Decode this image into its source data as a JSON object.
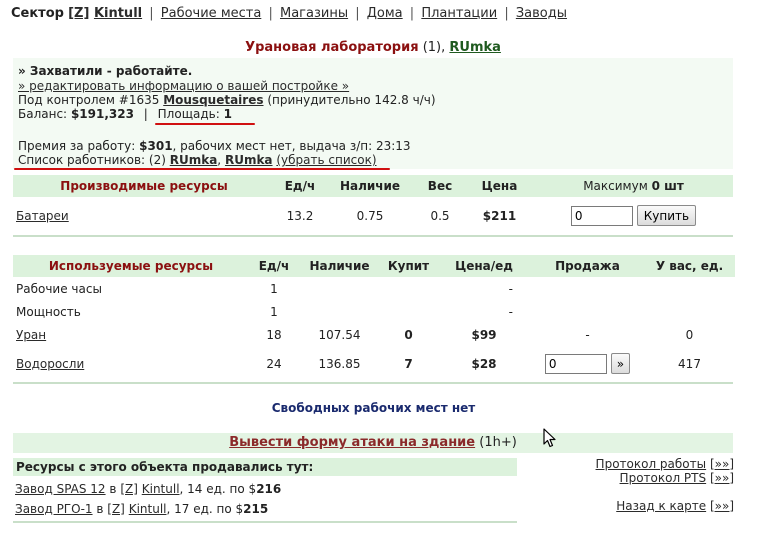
{
  "nav": {
    "sector_label": "Сектор",
    "clan_tag": "[Z]",
    "sector_name": "Kintull",
    "links": [
      "Рабочие места",
      "Магазины",
      "Дома",
      "Плантации",
      "Заводы"
    ],
    "separator": "|"
  },
  "building": {
    "name": "Урановая лаборатория",
    "level": "(1),",
    "owner": "RUmka",
    "status": "» Захватили - работайте.",
    "edit_link": "» редактировать информацию о вашей постройке »",
    "control_prefix": "Под контролем #1635",
    "control_group": "Mousquetaires",
    "control_suffix": "(принудительно 142.8 ч/ч)",
    "balance_label": "Баланс:",
    "balance_value": "$191,323",
    "divider": "|",
    "area_label": "Площадь:",
    "area_value": "1",
    "bonus_label": "Премия за работу:",
    "bonus_value": "$301",
    "bonus_suffix": ", рабочих мест нет, выдача з/п: 23:13",
    "workers_label": "Список работников: (2)",
    "worker1": "RUmka",
    "worker_sep": ",",
    "worker2": "RUmka",
    "remove_list": "(убрать список)"
  },
  "produced": {
    "headers": [
      "Производимые ресурсы",
      "Ед/ч",
      "Наличие",
      "Вес",
      "Цена"
    ],
    "max_label": "Максимум",
    "max_value": "0 шт",
    "row": {
      "name": "Батареи",
      "rate": "13.2",
      "stock": "0.75",
      "weight": "0.5",
      "price": "$211",
      "input": "0",
      "buy": "Купить"
    }
  },
  "used": {
    "headers": [
      "Используемые ресурсы",
      "Ед/ч",
      "Наличие",
      "Купит",
      "Цена/ед",
      "Продажа",
      "У вас, ед."
    ],
    "rows": [
      {
        "name": "Рабочие часы",
        "rate": "1",
        "stock": "",
        "buys": "",
        "price": "-",
        "sale": "",
        "have": "",
        "link": false
      },
      {
        "name": "Мощность",
        "rate": "1",
        "stock": "",
        "buys": "",
        "price": "-",
        "sale": "",
        "have": "",
        "link": false
      },
      {
        "name": "Уран",
        "rate": "18",
        "stock": "107.54",
        "buys": "0",
        "price": "$99",
        "sale": "-",
        "have": "0",
        "link": true
      },
      {
        "name": "Водоросли",
        "rate": "24",
        "stock": "136.85",
        "buys": "7",
        "price": "$28",
        "sale": "input",
        "have": "417",
        "link": true
      }
    ],
    "sale_input": "0",
    "sale_button": "»"
  },
  "free_places": "Свободных рабочих мест нет",
  "attack": {
    "link": "Вывести форму атаки на здание",
    "suffix": "(1h+)"
  },
  "sold": {
    "title": "Ресурсы с этого объекта продавались тут:",
    "rows": [
      {
        "factory": "Завод SPAS 12",
        "in": "в",
        "tag": "[Z]",
        "sector": "Kintull",
        "qty": ", 14 ед. по $",
        "price": "216"
      },
      {
        "factory": "Завод РГО-1",
        "in": "в",
        "tag": "[Z]",
        "sector": "Kintull",
        "qty": ", 17 ед. по $",
        "price": "215"
      }
    ]
  },
  "side_links": {
    "work_log": "Протокол работы",
    "pts_log": "Протокол PTS",
    "back_map": "Назад к карте",
    "arrow": "[»»]"
  },
  "colors": {
    "header_bg": "#dcf2dc",
    "accent_red": "#8b1010",
    "owner_green": "#1f5a1f",
    "marker_red": "#d01010"
  }
}
